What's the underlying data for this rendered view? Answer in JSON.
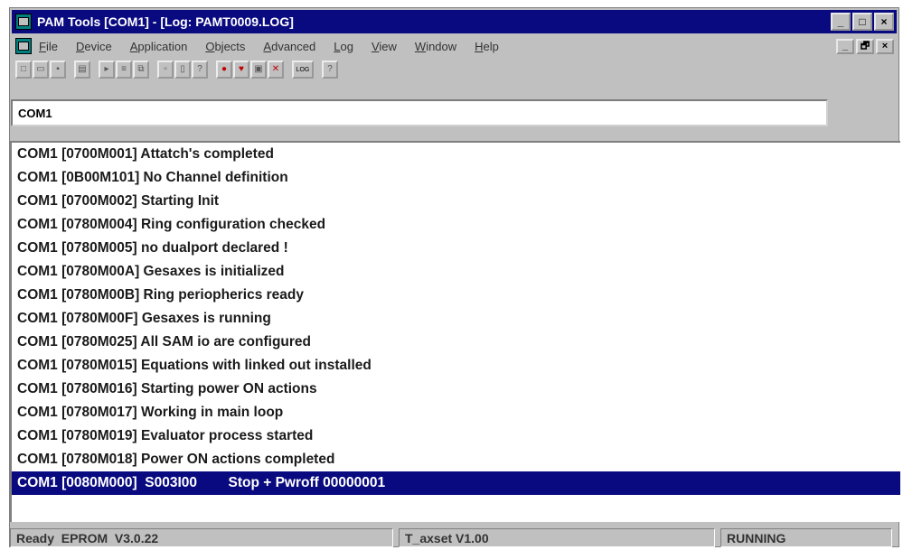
{
  "window": {
    "title": "PAM Tools [COM1] - [Log: PAMT0009.LOG]",
    "controls": [
      "_",
      "□",
      "×"
    ]
  },
  "menu": {
    "items": [
      "File",
      "Device",
      "Application",
      "Objects",
      "Advanced",
      "Log",
      "View",
      "Window",
      "Help"
    ],
    "mdi_controls": [
      "_",
      "🗗",
      "×"
    ]
  },
  "toolbar": {
    "buttons": [
      {
        "icon": "new-file-icon",
        "glyph": "□"
      },
      {
        "icon": "open-folder-icon",
        "glyph": "▭"
      },
      {
        "icon": "save-disk-icon",
        "glyph": "▪"
      },
      {
        "icon": "print-icon",
        "glyph": "▤"
      },
      {
        "icon": "open-object-icon",
        "glyph": "▸"
      },
      {
        "icon": "list-icon",
        "glyph": "≡"
      },
      {
        "icon": "compare-icon",
        "glyph": "⧉"
      },
      {
        "icon": "copy-icon",
        "glyph": "▫"
      },
      {
        "icon": "window-icon",
        "glyph": "▯"
      },
      {
        "icon": "context-help-icon",
        "glyph": "?"
      },
      {
        "icon": "stop-red-icon",
        "glyph": "●"
      },
      {
        "icon": "heart-icon",
        "glyph": "♥"
      },
      {
        "icon": "camera-icon",
        "glyph": "▣"
      },
      {
        "icon": "disconnect-icon",
        "glyph": "✕"
      },
      {
        "icon": "log-icon",
        "glyph": "LOG"
      },
      {
        "icon": "help-icon",
        "glyph": "?"
      }
    ]
  },
  "port_field": {
    "value": "COM1"
  },
  "log": {
    "lines": [
      "COM1 [0700M001] Attatch's completed",
      "COM1 [0B00M101] No Channel definition",
      "COM1 [0700M002] Starting Init",
      "COM1 [0780M004] Ring configuration checked",
      "COM1 [0780M005] no dualport declared !",
      "COM1 [0780M00A] Gesaxes is initialized",
      "COM1 [0780M00B] Ring periopherics ready",
      "COM1 [0780M00F] Gesaxes is running",
      "COM1 [0780M025] All SAM io are configured",
      "COM1 [0780M015] Equations with linked out installed",
      "COM1 [0780M016] Starting power ON actions",
      "COM1 [0780M017] Working in main loop",
      "COM1 [0780M019] Evaluator process started",
      "COM1 [0780M018] Power ON actions completed"
    ],
    "selected_line": "COM1 [0080M000]  S003I00        Stop + Pwroff 00000001"
  },
  "status": {
    "left": "Ready  EPROM  V3.0.22",
    "middle": "T_axset V1.00",
    "right": "RUNNING"
  },
  "colors": {
    "titlebar": "#0a0a80",
    "face": "#c0c0c0",
    "selection": "#0a0a80"
  }
}
